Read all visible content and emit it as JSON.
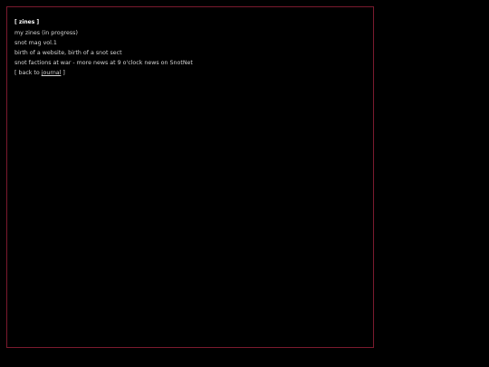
{
  "section": {
    "heading": "[ zines ]"
  },
  "entries": [
    "my zines (in progress)",
    "snot mag vol.1",
    "birth of a website, birth of a snot sect",
    "snot factions at war - more news at 9 o'clock news on SnotNet"
  ],
  "back": {
    "prefix": "[ back to ",
    "link_label": "journal",
    "suffix": " ]"
  },
  "colors": {
    "background": "#000000",
    "frame_border": "#7a1a2e",
    "text": "#d4d4d4"
  }
}
